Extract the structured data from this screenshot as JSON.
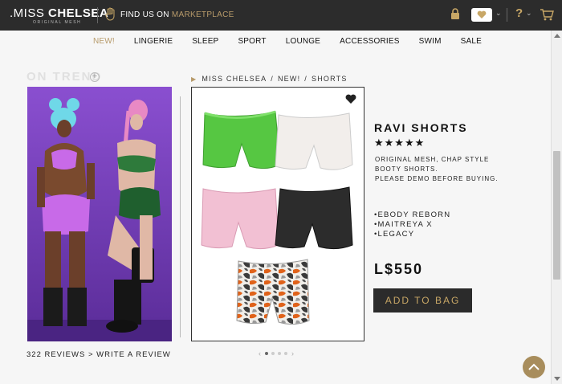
{
  "brand": {
    "name_light": ".MISS ",
    "name_bold": "CHELSEA",
    "tagline": "ORIGINAL MESH"
  },
  "header": {
    "find_us_prefix": "FIND US ON ",
    "find_us_link": "MARKETPLACE",
    "help_label": "?",
    "icons": [
      "hand-icon",
      "lock-icon",
      "heart-icon",
      "help-icon",
      "cart-icon"
    ]
  },
  "nav": {
    "items": [
      "NEW!",
      "LINGERIE",
      "SLEEP",
      "SPORT",
      "LOUNGE",
      "ACCESSORIES",
      "SWIM",
      "SALE"
    ],
    "active": "NEW!"
  },
  "left": {
    "section_title": "ON TREND",
    "plus": "+",
    "reviews_text": "322 REVIEWS > WRITE A REVIEW"
  },
  "breadcrumb": {
    "marker": "▶",
    "items": [
      "MISS CHELSEA",
      "NEW!",
      "SHORTS"
    ],
    "separator": "/"
  },
  "product": {
    "title": "RAVI SHORTS",
    "stars": "★★★★★",
    "rating": 5,
    "description": [
      "ORIGINAL MESH, CHAP STYLE",
      "BOOTY SHORTS.",
      "PLEASE DEMO BEFORE BUYING."
    ],
    "compatibility": [
      "•EBODY REBORN",
      "•MAITREYA X",
      "•LEGACY"
    ],
    "price": "L$550",
    "add_to_bag": "ADD TO BAG",
    "color_swatches": [
      "#56c742",
      "#f2eeeb",
      "#f2c0d3",
      "#2c2c2c",
      "camo-orange"
    ]
  },
  "carousel": {
    "prev": "‹",
    "next": "›",
    "dot_count": 4,
    "active_dot": 1
  },
  "colors": {
    "topbar_bg": "#2c2c2c",
    "accent_gold": "#b79a6a",
    "button_bg": "#2b2b2b"
  }
}
